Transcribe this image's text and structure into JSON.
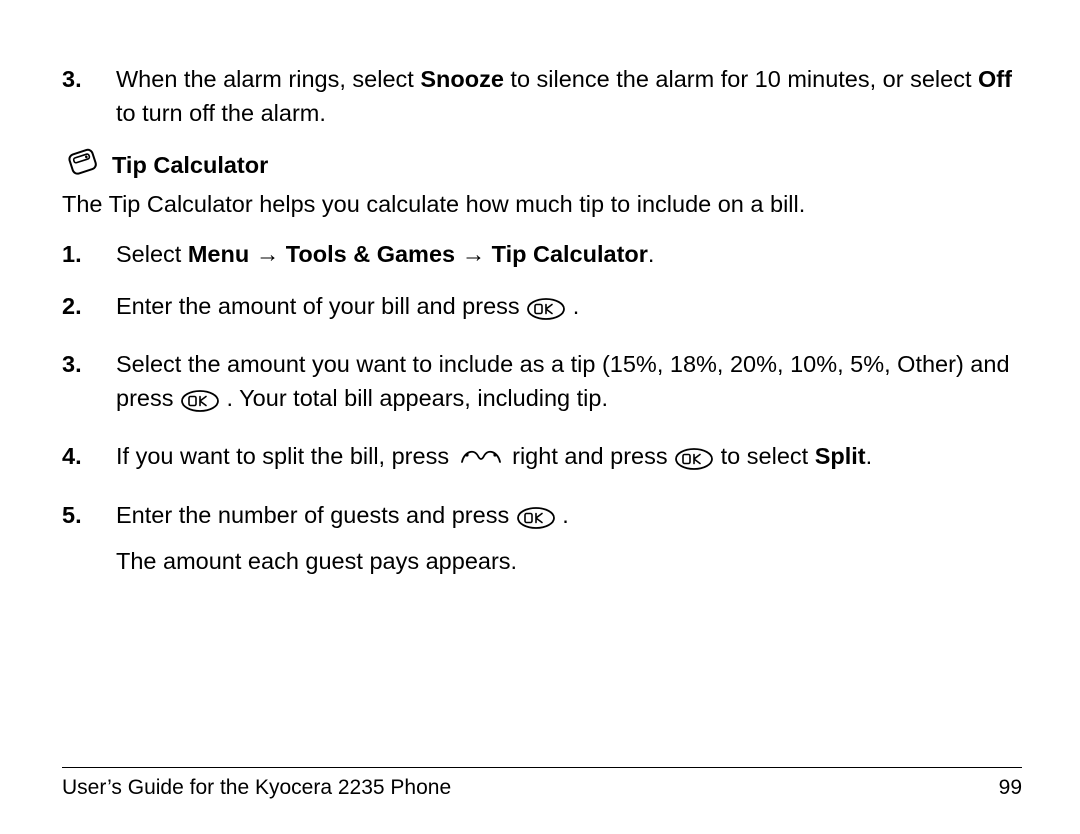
{
  "alarm_step": {
    "num": "3.",
    "t1": "When the alarm rings, select ",
    "b1": "Snooze",
    "t2": " to silence the alarm for 10 minutes, or select ",
    "b2": "Off",
    "t3": " to turn off the alarm."
  },
  "section": {
    "title": "Tip Calculator",
    "intro": "The Tip Calculator helps you calculate how much tip to include on a bill."
  },
  "steps": {
    "s1": {
      "num": "1.",
      "t1": "Select ",
      "b1": "Menu → Tools & Games → Tip Calculator",
      "t2": "."
    },
    "s2": {
      "num": "2.",
      "t1": "Enter the amount of your bill and press ",
      "t2": " ."
    },
    "s3": {
      "num": "3.",
      "t1": "Select the amount you want to include as a tip (15%, 18%, 20%, 10%, 5%, Other) and press ",
      "t2": " . Your total bill appears, including tip."
    },
    "s4": {
      "num": "4.",
      "t1": "If you want to split the bill, press ",
      "t2": " right and press ",
      "t3": " to select ",
      "b1": "Split",
      "t4": "."
    },
    "s5": {
      "num": "5.",
      "t1": "Enter the number of guests and press ",
      "t2": " .",
      "after": "The amount each guest pays appears."
    }
  },
  "footer": {
    "title": "User’s Guide for the Kyocera 2235 Phone",
    "page": "99"
  }
}
